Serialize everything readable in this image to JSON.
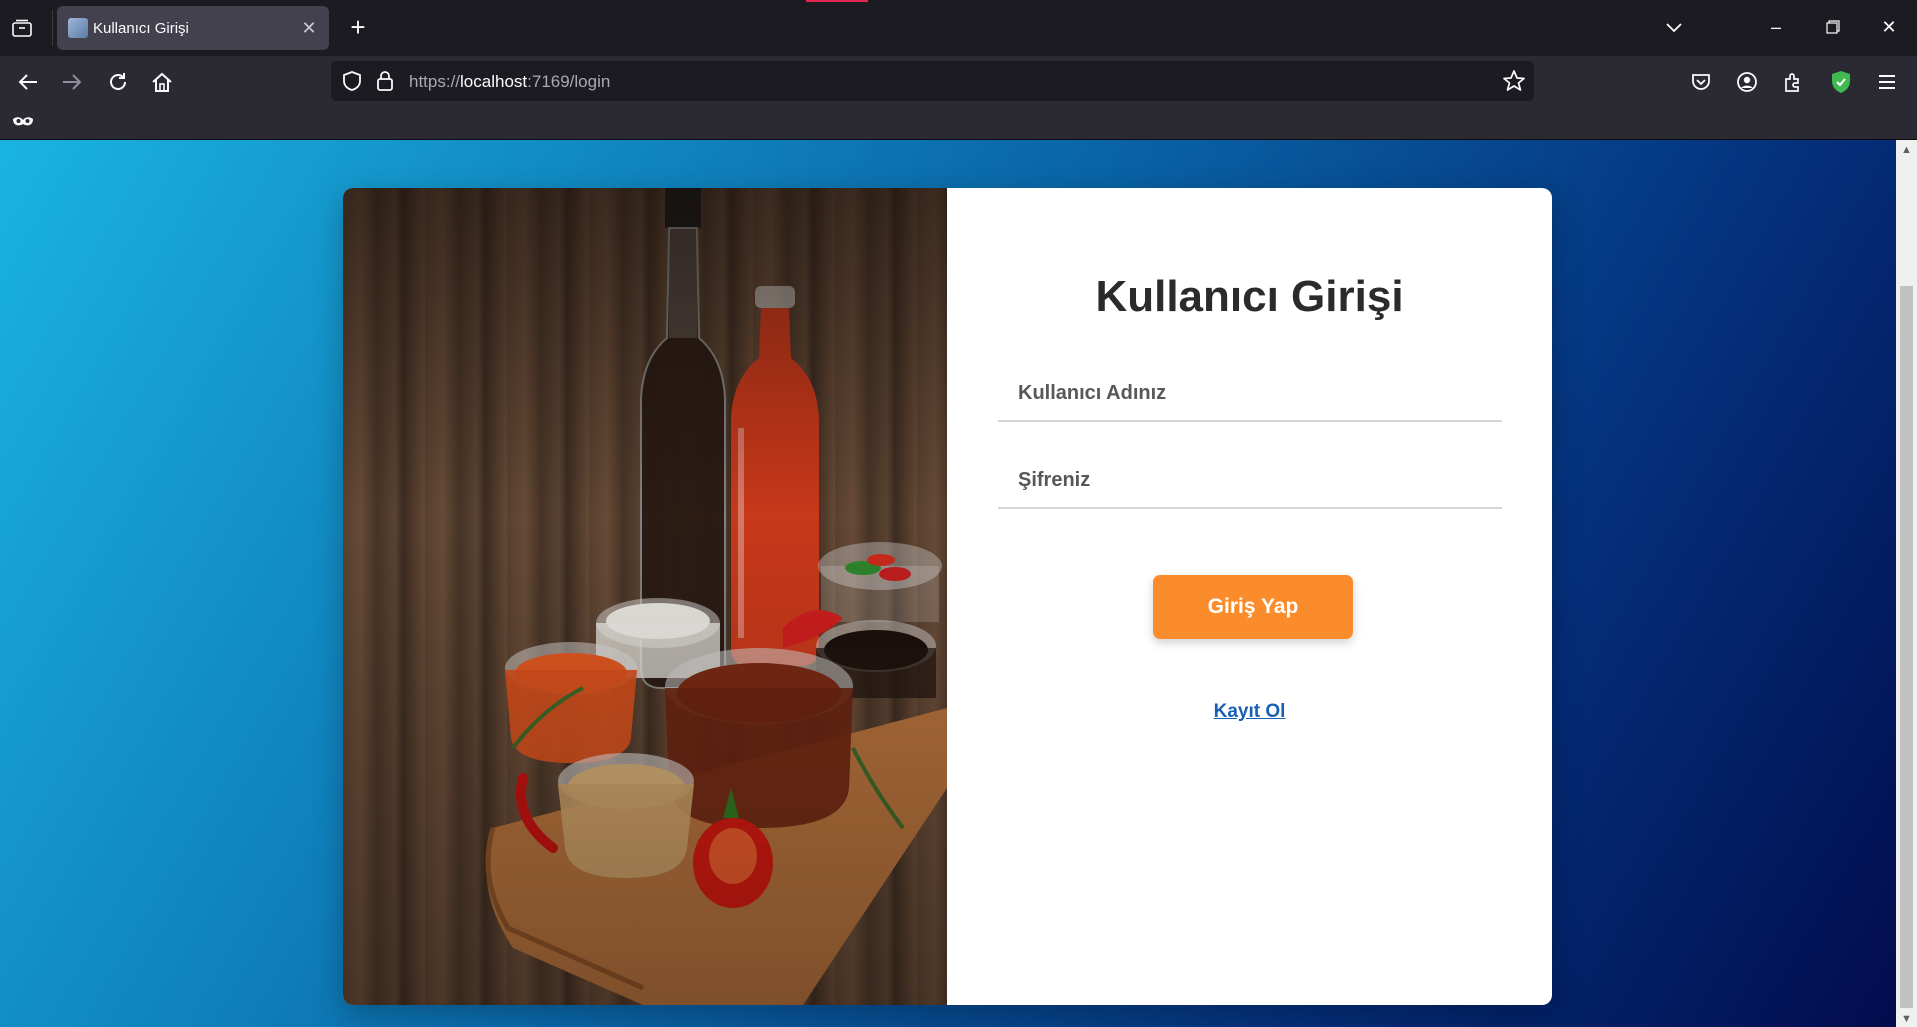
{
  "browser": {
    "tab_title": "Kullanıcı Girişi",
    "url_prefix": "https://",
    "url_host": "localhost",
    "url_rest": ":7169/login",
    "icons": {
      "tab_list": "tab-list-icon",
      "new_tab": "plus-icon",
      "back": "arrow-left-icon",
      "forward": "arrow-right-icon",
      "reload": "reload-icon",
      "home": "home-icon",
      "shield": "shield-icon",
      "lock": "lock-icon",
      "bookmark_star": "star-icon",
      "pocket": "pocket-icon",
      "account": "account-icon",
      "extensions": "puzzle-icon",
      "ublock": "ublock-shield-icon",
      "menu": "hamburger-menu-icon",
      "bookmark_item": "mask-icon"
    }
  },
  "login": {
    "title": "Kullanıcı Girişi",
    "username_placeholder": "Kullanıcı Adınız",
    "password_placeholder": "Şifreniz",
    "submit_label": "Giriş Yap",
    "register_label": "Kayıt Ol"
  },
  "colors": {
    "button": "#fb8c2c",
    "link": "#1a5fb4",
    "bg_start": "#1ab3e1",
    "bg_end": "#020c4d"
  }
}
